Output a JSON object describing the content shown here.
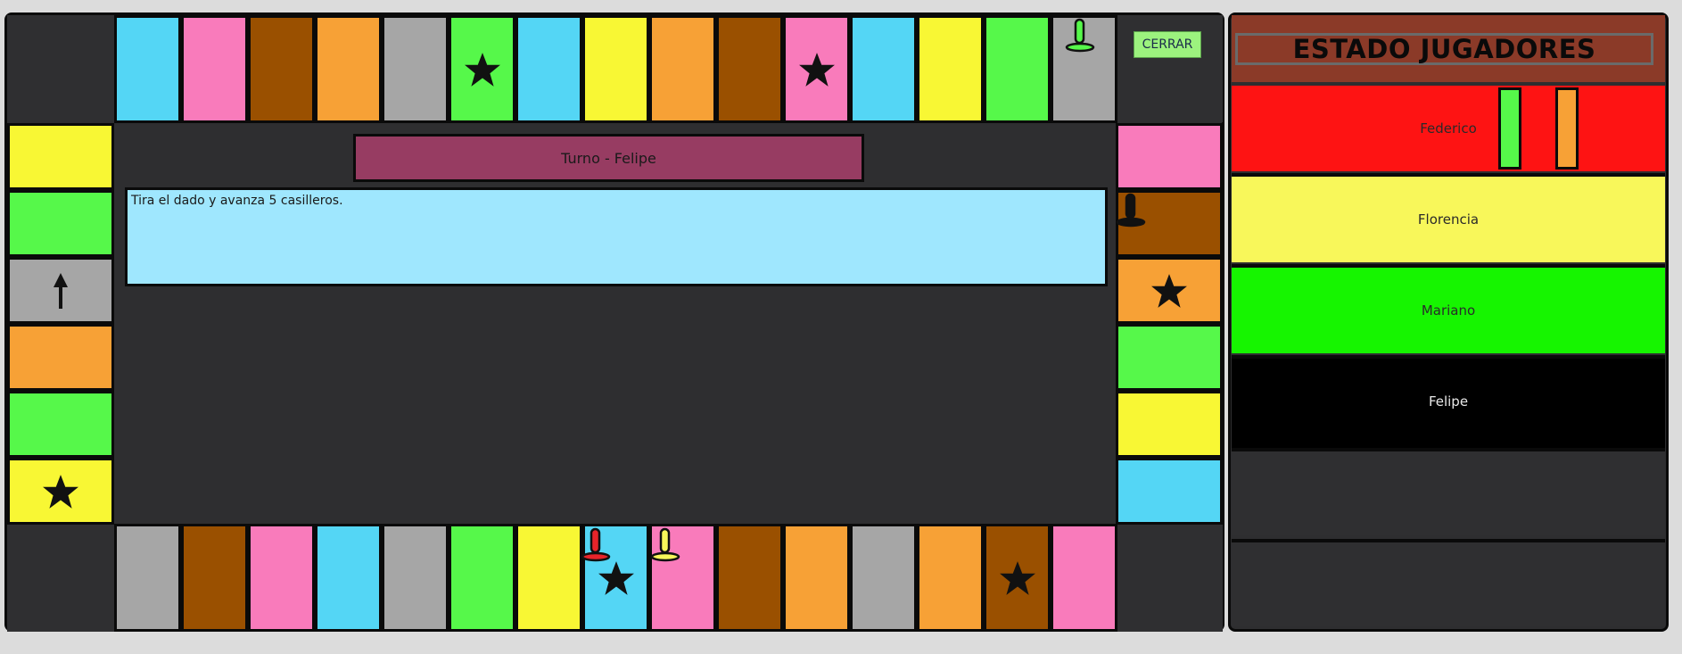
{
  "close_label": "CERRAR",
  "turn_label": "Turno - Felipe",
  "message": "Tira el dado y avanza 5 casilleros.",
  "panel_title": "ESTADO JUGADORES",
  "colors": {
    "cyan": "#54d6f5",
    "pink": "#f97bbb",
    "brown": "#9a5000",
    "orange": "#f7a136",
    "gray": "#a6a6a6",
    "green": "#56f84a",
    "yellow": "#f8f734",
    "red_player": "#fe1313",
    "yellow_player": "#f8f75a",
    "green_player": "#16f500",
    "black_player": "#000000"
  },
  "board": {
    "top_row": [
      {
        "color": "cyan"
      },
      {
        "color": "pink"
      },
      {
        "color": "brown"
      },
      {
        "color": "orange"
      },
      {
        "color": "gray"
      },
      {
        "color": "green",
        "icon": "star-icon"
      },
      {
        "color": "cyan"
      },
      {
        "color": "yellow"
      },
      {
        "color": "orange"
      },
      {
        "color": "brown"
      },
      {
        "color": "pink",
        "icon": "star-icon"
      },
      {
        "color": "cyan"
      },
      {
        "color": "yellow"
      },
      {
        "color": "green"
      },
      {
        "color": "gray",
        "pawn": "green"
      }
    ],
    "left_col": [
      {
        "color": "yellow"
      },
      {
        "color": "green"
      },
      {
        "color": "gray",
        "icon": "arrow-up-icon"
      },
      {
        "color": "orange"
      },
      {
        "color": "green"
      },
      {
        "color": "yellow",
        "icon": "star-icon"
      }
    ],
    "right_col": [
      {
        "color": "pink"
      },
      {
        "color": "brown",
        "pawn": "black"
      },
      {
        "color": "orange",
        "icon": "star-icon"
      },
      {
        "color": "green"
      },
      {
        "color": "yellow"
      },
      {
        "color": "cyan"
      }
    ],
    "bottom_row": [
      {
        "color": "gray"
      },
      {
        "color": "brown"
      },
      {
        "color": "pink"
      },
      {
        "color": "cyan"
      },
      {
        "color": "gray"
      },
      {
        "color": "green"
      },
      {
        "color": "yellow"
      },
      {
        "color": "cyan",
        "icon": "star-icon",
        "pawn": "red"
      },
      {
        "color": "pink",
        "pawn": "yellow"
      },
      {
        "color": "brown"
      },
      {
        "color": "orange"
      },
      {
        "color": "gray"
      },
      {
        "color": "orange"
      },
      {
        "color": "brown",
        "icon": "star-icon"
      },
      {
        "color": "pink"
      }
    ]
  },
  "players": [
    {
      "name": "Federico",
      "color": "red_player",
      "text_color": "#2a2a2a",
      "chips": [
        "green",
        "orange"
      ]
    },
    {
      "name": "Florencia",
      "color": "yellow_player",
      "text_color": "#2a2a2a",
      "chips": []
    },
    {
      "name": "Mariano",
      "color": "green_player",
      "text_color": "#2a2a2a",
      "chips": []
    },
    {
      "name": "Felipe",
      "color": "black_player",
      "text_color": "#e8e8e8",
      "chips": []
    },
    {
      "name": "",
      "color": "empty",
      "text_color": "#e8e8e8",
      "chips": []
    },
    {
      "name": "",
      "color": "empty",
      "text_color": "#e8e8e8",
      "chips": []
    }
  ]
}
